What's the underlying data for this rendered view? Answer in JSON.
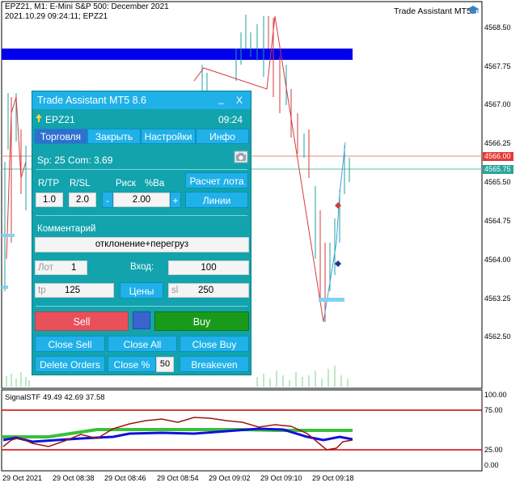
{
  "chart": {
    "header_line1": "EPZ21, M1:  E-Mini S&P 500: December 2021",
    "header_line2": "2021.10.29 09:24:11; EPZ21",
    "ea_name": "Trade Assistant MT5",
    "ea_icon": "graduation-cap-icon",
    "price_ticks": [
      "4568.50",
      "4567.75",
      "4567.00",
      "4566.25",
      "4565.50",
      "4564.75",
      "4564.00",
      "4563.25",
      "4562.50"
    ],
    "ask_price": "4566.00",
    "bid_price": "4565.75",
    "ask_color": "#e53935",
    "bid_color": "#26a69a",
    "indicator_label": "SignalSTF 49.49 42.69 37.58",
    "indicator_ticks": [
      "100.00",
      "75.00",
      "25.00",
      "0.00"
    ],
    "time_ticks": [
      "29 Oct 2021",
      "29 Oct 08:38",
      "29 Oct 08:46",
      "29 Oct 08:54",
      "29 Oct 09:02",
      "29 Oct 09:10",
      "29 Oct 09:18"
    ],
    "trend_line_color": "#0000ee"
  },
  "panel": {
    "title": "Trade Assistant MT5 8.6",
    "minimize": "_",
    "close": "X",
    "symbol": "EPZ21",
    "time": "09:24",
    "tabs": [
      "Торговля",
      "Закрыть",
      "Настройки",
      "Инфо"
    ],
    "spread": "Sp: 25  Com: 3.69",
    "camera_icon": "camera-icon",
    "rtp_label": "R/TP",
    "rsl_label": "R/SL",
    "risk_label": "Риск",
    "percent_label": "%Ва",
    "rtp_value": "1.0",
    "rsl_value": "2.0",
    "minus": "-",
    "risk_value": "2.00",
    "plus": "+",
    "calc_lot": "Расчет лота",
    "lines": "Линии",
    "comment_label": "Комментарий",
    "comment_value": "отклонение+перегруз",
    "lot_label": "Лот",
    "lot_value": "1",
    "entry_label": "Вход:",
    "entry_value": "100",
    "tp_label": "tp",
    "tp_value": "125",
    "prices_button": "Цены",
    "sl_label": "sl",
    "sl_value": "250",
    "sell": "Sell",
    "buy": "Buy",
    "close_sell": "Close Sell",
    "close_all": "Close All",
    "close_buy": "Close Buy",
    "delete_orders": "Delete Orders",
    "close_percent": "Close %",
    "close_percent_value": "50",
    "breakeven": "Breakeven",
    "sell_color": "#e8505b",
    "buy_color": "#1a9a1a",
    "mid_color": "#3b63d0"
  }
}
